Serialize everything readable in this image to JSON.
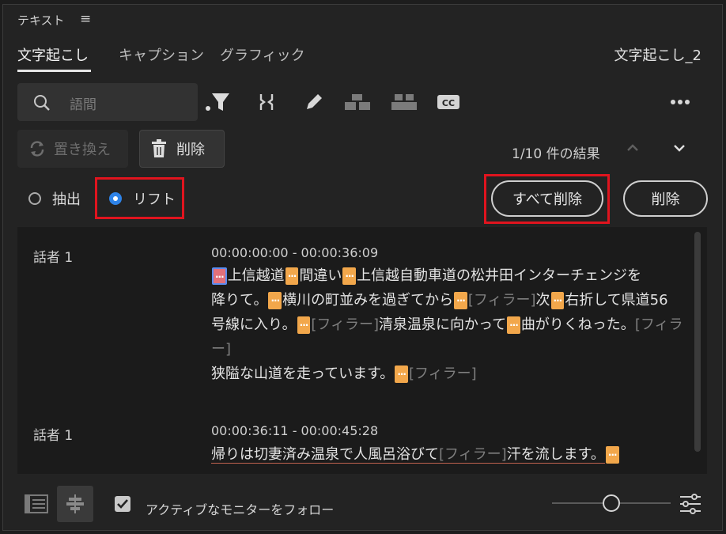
{
  "panel": {
    "title": "テキスト",
    "menu_glyph": "≡"
  },
  "tabs": [
    {
      "label": "文字起こし",
      "active": true
    },
    {
      "label": "キャプション",
      "active": false
    },
    {
      "label": "グラフィック",
      "active": false
    }
  ],
  "sequence_name": "文字起こし_2",
  "search": {
    "placeholder": "語間"
  },
  "toolbar_icons": [
    "filter-icon",
    "merge-icon",
    "pencil-icon",
    "split-segment-icon",
    "merge-segment-icon",
    "cc-icon",
    "more-icon"
  ],
  "actions": {
    "replace_label": "置き換え",
    "delete_label": "削除"
  },
  "results": {
    "text": "1/10 件の結果"
  },
  "mode": {
    "extract_label": "抽出",
    "lift_label": "リフト",
    "selected": "lift"
  },
  "buttons": {
    "delete_all": "すべて削除",
    "delete": "削除"
  },
  "colors": {
    "pause": "#f2a74b",
    "radio_selected": "#2e83e8",
    "highlight_box": "#e0141e"
  },
  "segments": [
    {
      "speaker": "話者 1",
      "timecode": "00:00:00:00 - 00:00:36:09",
      "parts": {
        "p1": "上信越道",
        "p2": "間違い",
        "p3": "上信越自動車道の松井田インターチェンジを",
        "p4": "降りて。",
        "p5": "横川の町並みを過ぎてから",
        "f1": "[フィラー]",
        "p6": "次",
        "p7": "右折して県道56",
        "p8": "号線に入り。",
        "f2": "[フィラー]",
        "p9": "清泉温泉に向かって",
        "p10": "曲がりくねった。",
        "f3": "[フィラー]",
        "p11": "狭隘な山道を走っています。",
        "f4": "[フィラー]"
      }
    },
    {
      "speaker": "話者 1",
      "timecode": "00:00:36:11 - 00:00:45:28",
      "parts": {
        "p1": "帰りは切妻済み温泉で人風呂浴びて",
        "f1": "[フィラー]",
        "p2": "汗を流します。"
      }
    }
  ],
  "pause_glyph": "···",
  "footer": {
    "follow_label": "アクティブなモニターをフォロー",
    "follow_checked": true
  }
}
